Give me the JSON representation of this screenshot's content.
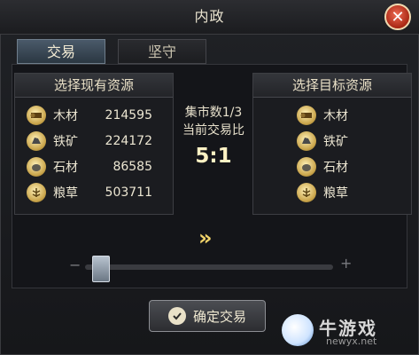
{
  "window": {
    "title": "内政"
  },
  "tabs": [
    {
      "label": "交易",
      "active": true
    },
    {
      "label": "坚守",
      "active": false
    }
  ],
  "left_box": {
    "header": "选择现有资源",
    "items": [
      {
        "icon": "wood-icon",
        "name": "木材",
        "value": "214595"
      },
      {
        "icon": "iron-ore-icon",
        "name": "铁矿",
        "value": "224172"
      },
      {
        "icon": "stone-icon",
        "name": "石材",
        "value": "86585"
      },
      {
        "icon": "grain-icon",
        "name": "粮草",
        "value": "503711"
      }
    ]
  },
  "right_box": {
    "header": "选择目标资源",
    "items": [
      {
        "icon": "wood-icon",
        "name": "木材"
      },
      {
        "icon": "iron-ore-icon",
        "name": "铁矿"
      },
      {
        "icon": "stone-icon",
        "name": "石材"
      },
      {
        "icon": "grain-icon",
        "name": "粮草"
      }
    ]
  },
  "market": {
    "count_label": "集市数1/3",
    "ratio_label": "当前交易比",
    "ratio": "5:1"
  },
  "arrow": "»",
  "slider": {
    "minus": "−",
    "plus": "+",
    "value_fraction": 0.03
  },
  "confirm_button": {
    "label": "确定交易"
  },
  "watermark": {
    "text": "牛游戏",
    "url": "newyx.net"
  }
}
